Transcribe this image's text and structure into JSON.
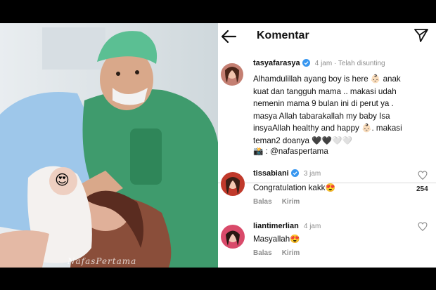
{
  "header": {
    "title": "Komentar"
  },
  "post": {
    "username": "tasyafarasya",
    "meta": "4 jam · Telah disunting",
    "caption_lines": [
      "Alhamdulillah ayang boy is here 👶🏻 anak",
      "kuat dan tangguh mama .. makasi udah",
      "nemenin mama 9 bulan ini di perut ya .",
      "masya Allah tabarakallah my baby Isa",
      "insyaAllah healthy and happy 👶🏻. makasi",
      "teman2 doanya 🖤🖤🤍🤍"
    ],
    "credit": "📸 : @nafaspertama"
  },
  "comments": [
    {
      "username": "tissabiani",
      "time": "3 jam",
      "text": "Congratulation kakk😍",
      "likes": "254",
      "reply": "Balas",
      "send": "Kirim"
    },
    {
      "username": "liantimerlian",
      "time": "4 jam",
      "text": "Masyallah😍",
      "reply": "Balas",
      "send": "Kirim"
    }
  ],
  "photo": {
    "watermark": "NafasPertama",
    "face_sticker": "😍"
  },
  "colors": {
    "accent_verified": "#3897f0",
    "meta_gray": "#8e8e8e",
    "scrubs": "#3f9b6d",
    "background": "#000000"
  }
}
